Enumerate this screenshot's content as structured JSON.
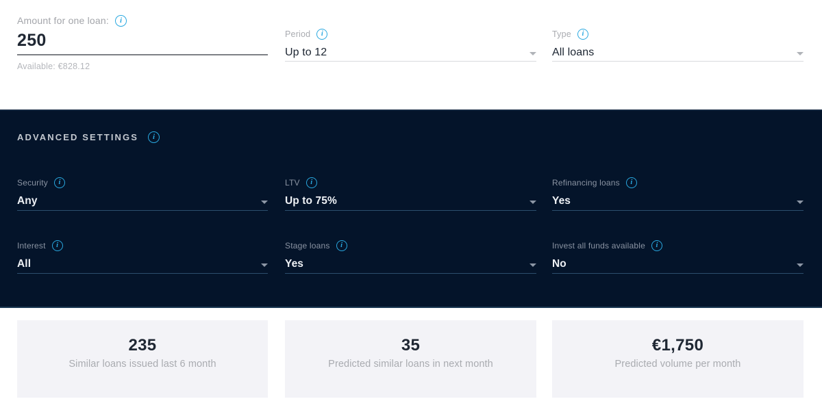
{
  "colors": {
    "panel_dark": "#04142a",
    "accent_blue": "#29a8e0",
    "card_bg": "#f3f3f7",
    "muted_text": "#a9abb0",
    "value_text": "#1f2733"
  },
  "icons": {
    "info": "i",
    "caret_down": "chevron-down-icon"
  },
  "top_section": {
    "amount": {
      "label": "Amount for one loan:",
      "value": "250",
      "available": "Available: €828.12"
    },
    "period": {
      "label": "Period",
      "value": "Up to 12"
    },
    "type": {
      "label": "Type",
      "value": "All loans"
    }
  },
  "advanced_settings": {
    "title": "ADVANCED SETTINGS",
    "fields": [
      {
        "label": "Security",
        "value": "Any"
      },
      {
        "label": "LTV",
        "value": "Up to 75%"
      },
      {
        "label": "Refinancing loans",
        "value": "Yes"
      },
      {
        "label": "Interest",
        "value": "All"
      },
      {
        "label": "Stage loans",
        "value": "Yes"
      },
      {
        "label": "Invest all funds available",
        "value": "No"
      }
    ]
  },
  "stats": [
    {
      "value": "235",
      "label": "Similar loans issued last 6 month"
    },
    {
      "value": "35",
      "label": "Predicted similar loans in next month"
    },
    {
      "value": "€1,750",
      "label": "Predicted volume per month"
    }
  ]
}
